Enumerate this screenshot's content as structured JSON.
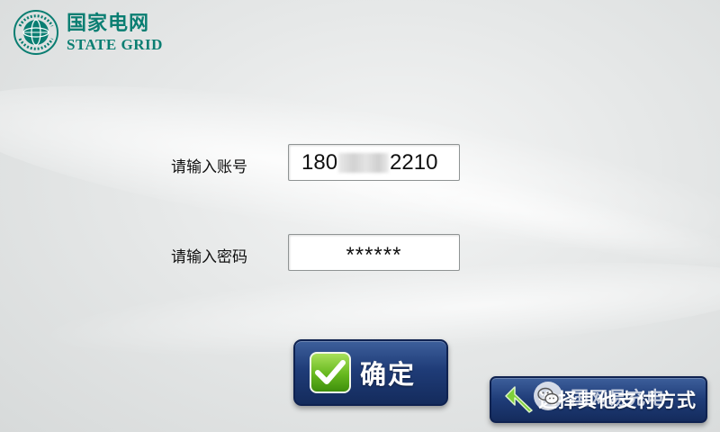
{
  "brand": {
    "name_cn": "国家电网",
    "name_en": "STATE GRID",
    "color": "#0a7e72"
  },
  "form": {
    "account_label": "请输入账号",
    "account_value_prefix": "180",
    "account_value_suffix": "2210",
    "password_label": "请输入密码",
    "password_value": "******"
  },
  "buttons": {
    "confirm_label": "确定",
    "confirm_icon": "checkmark-icon",
    "other_label": "选择其他支付方式",
    "other_icon": "back-arrow-icon"
  },
  "watermark": {
    "text": "国网易充电",
    "icon": "wechat-icon"
  },
  "colors": {
    "button_blue": "#1f3c78",
    "check_green": "#66b81e"
  }
}
